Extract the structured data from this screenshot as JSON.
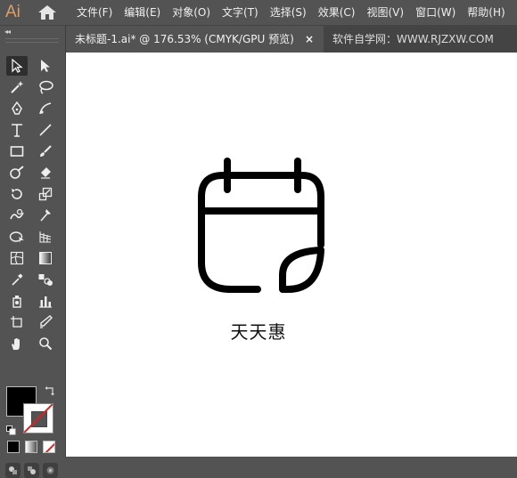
{
  "app": {
    "logo_text": "Ai"
  },
  "menubar": {
    "items": [
      "文件(F)",
      "编辑(E)",
      "对象(O)",
      "文字(T)",
      "选择(S)",
      "效果(C)",
      "视图(V)",
      "窗口(W)",
      "帮助(H)"
    ]
  },
  "toolpanel": {
    "collapse_glyph": "◂◂"
  },
  "tabs": [
    {
      "label": "未标题-1.ai* @ 176.53% (CMYK/GPU 预览)",
      "close": "×",
      "active": true
    },
    {
      "label": "软件自学网：WWW.RJZXW.COM",
      "active": false
    }
  ],
  "canvas": {
    "caption": "天天惠"
  },
  "colors": {
    "chrome": "#535353",
    "tab_inactive": "#444444",
    "logo": "#d9a06b",
    "canvas": "#ffffff",
    "artwork": "#000000"
  },
  "icons": [
    "home-icon",
    "selection-tool-icon",
    "direct-selection-tool-icon",
    "magic-wand-icon",
    "lasso-icon",
    "pen-icon",
    "curvature-icon",
    "type-icon",
    "line-segment-icon",
    "rectangle-icon",
    "paintbrush-icon",
    "shaper-icon",
    "eraser-icon",
    "rotate-icon",
    "scale-icon",
    "warp-icon",
    "puppet-warp-icon",
    "free-transform-icon",
    "shape-builder-icon",
    "perspective-grid-icon",
    "mesh-icon",
    "gradient-icon",
    "eyedropper-icon",
    "blend-icon",
    "symbol-sprayer-icon",
    "column-graph-icon",
    "artboard-icon",
    "slice-icon",
    "hand-icon",
    "zoom-icon",
    "swap-icon",
    "default-colors-icon"
  ]
}
